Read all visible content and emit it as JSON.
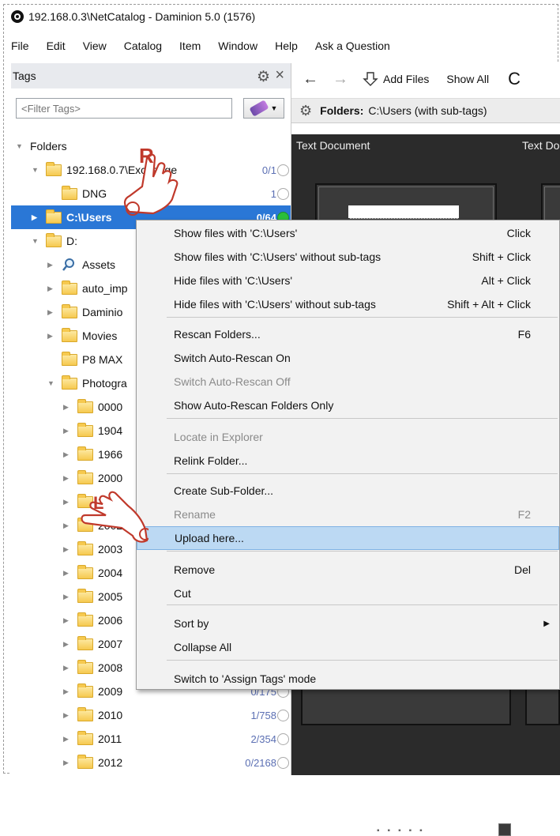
{
  "window": {
    "title": "192.168.0.3\\NetCatalog - Daminion 5.0 (1576)"
  },
  "menubar": [
    "File",
    "Edit",
    "View",
    "Catalog",
    "Item",
    "Window",
    "Help",
    "Ask a Question"
  ],
  "tags_panel": {
    "title": "Tags",
    "filter_placeholder": "<Filter Tags>",
    "tree": [
      {
        "label": "Folders",
        "count": "",
        "expanded": true
      },
      {
        "label": "192.168.0.7\\Exchange",
        "count": "0/1"
      },
      {
        "label": "DNG",
        "count": "1"
      },
      {
        "label": "C:\\Users",
        "count": "0/64",
        "selected": true
      },
      {
        "label": "D:",
        "count": ""
      },
      {
        "label": "Assets",
        "count": ""
      },
      {
        "label": "auto_imp",
        "count": ""
      },
      {
        "label": "Daminio",
        "count": ""
      },
      {
        "label": "Movies",
        "count": ""
      },
      {
        "label": "P8 MAX",
        "count": ""
      },
      {
        "label": "Photogra",
        "count": ""
      },
      {
        "label": "0000",
        "count": ""
      },
      {
        "label": "1904",
        "count": ""
      },
      {
        "label": "1966",
        "count": ""
      },
      {
        "label": "2000",
        "count": ""
      },
      {
        "label": "2001",
        "count": ""
      },
      {
        "label": "2002",
        "count": ""
      },
      {
        "label": "2003",
        "count": ""
      },
      {
        "label": "2004",
        "count": ""
      },
      {
        "label": "2005",
        "count": ""
      },
      {
        "label": "2006",
        "count": ""
      },
      {
        "label": "2007",
        "count": ""
      },
      {
        "label": "2008",
        "count": ""
      },
      {
        "label": "2009",
        "count": "0/175"
      },
      {
        "label": "2010",
        "count": "1/758"
      },
      {
        "label": "2011",
        "count": "2/354"
      },
      {
        "label": "2012",
        "count": "0/2168"
      }
    ]
  },
  "toolbar": {
    "add_files": "Add Files",
    "show_all": "Show All"
  },
  "folder_bar": {
    "label": "Folders:",
    "path": "C:\\Users (with sub-tags)"
  },
  "viewer": {
    "header1": "Text Document",
    "header2": "Text Do"
  },
  "context_menu": [
    {
      "label": "Show files with 'C:\\Users'",
      "shortcut": "Click"
    },
    {
      "label": "Show files with 'C:\\Users' without sub-tags",
      "shortcut": "Shift + Click"
    },
    {
      "label": "Hide files with 'C:\\Users'",
      "shortcut": "Alt + Click"
    },
    {
      "label": "Hide files with 'C:\\Users' without sub-tags",
      "shortcut": "Shift + Alt + Click"
    },
    {
      "label": "Rescan Folders...",
      "shortcut": "F6"
    },
    {
      "label": "Switch Auto-Rescan On",
      "shortcut": ""
    },
    {
      "label": "Switch Auto-Rescan Off",
      "shortcut": "",
      "disabled": true
    },
    {
      "label": "Show Auto-Rescan Folders Only",
      "shortcut": ""
    },
    {
      "label": "Locate in Explorer",
      "shortcut": "",
      "disabled": true
    },
    {
      "label": "Relink Folder...",
      "shortcut": ""
    },
    {
      "label": "Create Sub-Folder...",
      "shortcut": ""
    },
    {
      "label": "Rename",
      "shortcut": "F2",
      "disabled": true
    },
    {
      "label": "Upload here...",
      "shortcut": "",
      "hover": true
    },
    {
      "label": "Remove",
      "shortcut": "Del"
    },
    {
      "label": "Cut",
      "shortcut": ""
    },
    {
      "label": "Sort by",
      "shortcut": "",
      "submenu": true
    },
    {
      "label": "Collapse All",
      "shortcut": ""
    },
    {
      "label": "Switch to 'Assign Tags' mode",
      "shortcut": ""
    }
  ],
  "annotations": {
    "right_click_letter": "R",
    "left_click_letter": "L"
  },
  "colors": {
    "selection": "#2a77d6",
    "menu_hover": "#bcd9f3",
    "viewer_bg": "#2b2b2b",
    "status_green": "#2bbf3a"
  },
  "icons": [
    "app-icon",
    "gear-icon",
    "close-icon",
    "tag-filter-icon",
    "back-arrow-icon",
    "forward-arrow-icon",
    "add-files-icon",
    "refresh-icon",
    "folder-icon",
    "magnifier-icon",
    "hand-pointer-icon"
  ]
}
